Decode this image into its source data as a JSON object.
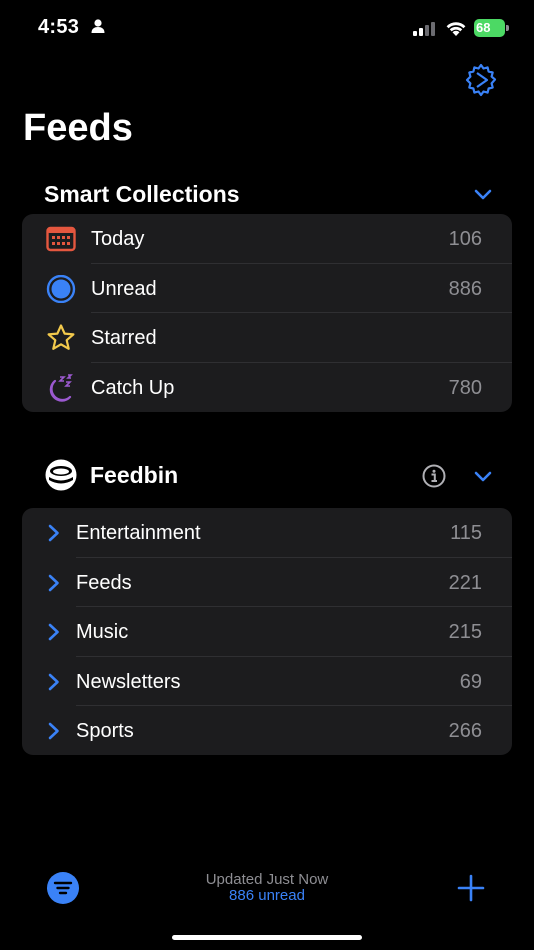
{
  "status": {
    "time": "4:53",
    "battery": "68"
  },
  "page_title": "Feeds",
  "smart_collections": {
    "title": "Smart Collections",
    "items": [
      {
        "label": "Today",
        "count": "106",
        "icon": "calendar-icon"
      },
      {
        "label": "Unread",
        "count": "886",
        "icon": "unread-circle-icon"
      },
      {
        "label": "Starred",
        "count": "",
        "icon": "star-icon"
      },
      {
        "label": "Catch Up",
        "count": "780",
        "icon": "moon-zzz-icon"
      }
    ]
  },
  "account": {
    "title": "Feedbin",
    "folders": [
      {
        "label": "Entertainment",
        "count": "115"
      },
      {
        "label": "Feeds",
        "count": "221"
      },
      {
        "label": "Music",
        "count": "215"
      },
      {
        "label": "Newsletters",
        "count": "69"
      },
      {
        "label": "Sports",
        "count": "266"
      }
    ]
  },
  "toolbar": {
    "updated": "Updated Just Now",
    "unread": "886 unread"
  },
  "colors": {
    "accent": "#3a82f7",
    "background": "#000000",
    "group_bg": "#1c1c1e",
    "count": "#8e8e93",
    "today": "#e5573f",
    "star": "#f2c94c",
    "catchup": "#9b59d0",
    "battery": "#4cd964"
  }
}
